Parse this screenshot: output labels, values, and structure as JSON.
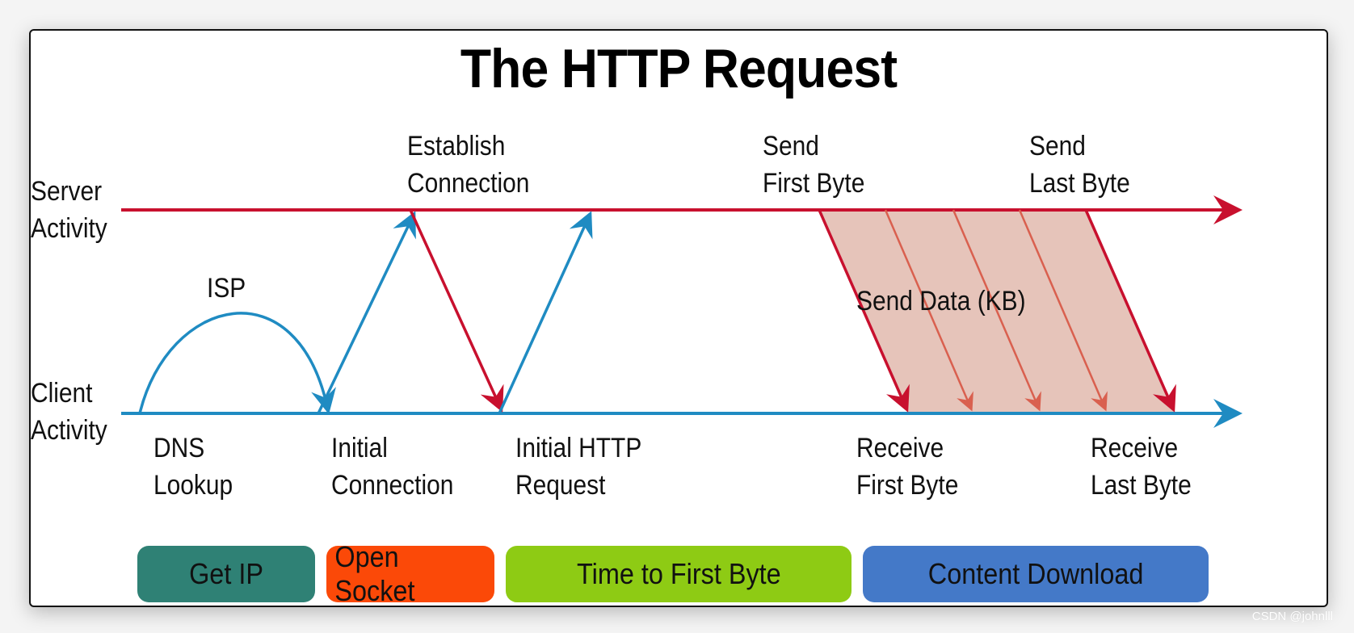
{
  "title": "The HTTP Request",
  "rows": {
    "server": "Server\nActivity",
    "client": "Client\nActivity"
  },
  "colors": {
    "server_line": "#c8102e",
    "client_line": "#1f8bc2",
    "data_fill": "#e6c4ba",
    "data_arrow_light": "#d9604f",
    "get_ip": "#2f8175",
    "open_socket": "#fb4908",
    "ttfb": "#8ecb14",
    "content_download": "#4479c8"
  },
  "server_events": [
    {
      "id": "establish",
      "label": "Establish\nConnection"
    },
    {
      "id": "send-first",
      "label": "Send\nFirst Byte"
    },
    {
      "id": "send-last",
      "label": "Send\nLast Byte"
    }
  ],
  "client_events": [
    {
      "id": "dns",
      "label": "DNS\nLookup"
    },
    {
      "id": "initial-conn",
      "label": "Initial\nConnection"
    },
    {
      "id": "initial-http",
      "label": "Initial HTTP\nRequest"
    },
    {
      "id": "recv-first",
      "label": "Receive\nFirst Byte"
    },
    {
      "id": "recv-last",
      "label": "Receive\nLast Byte"
    }
  ],
  "annotations": {
    "isp": "ISP",
    "send_data": "Send Data (KB)"
  },
  "phases": [
    {
      "id": "get-ip",
      "label": "Get IP"
    },
    {
      "id": "open-socket",
      "label": "Open Socket"
    },
    {
      "id": "ttfb",
      "label": "Time to First Byte"
    },
    {
      "id": "content-download",
      "label": "Content Download"
    }
  ],
  "watermark": "CSDN @johnlll"
}
